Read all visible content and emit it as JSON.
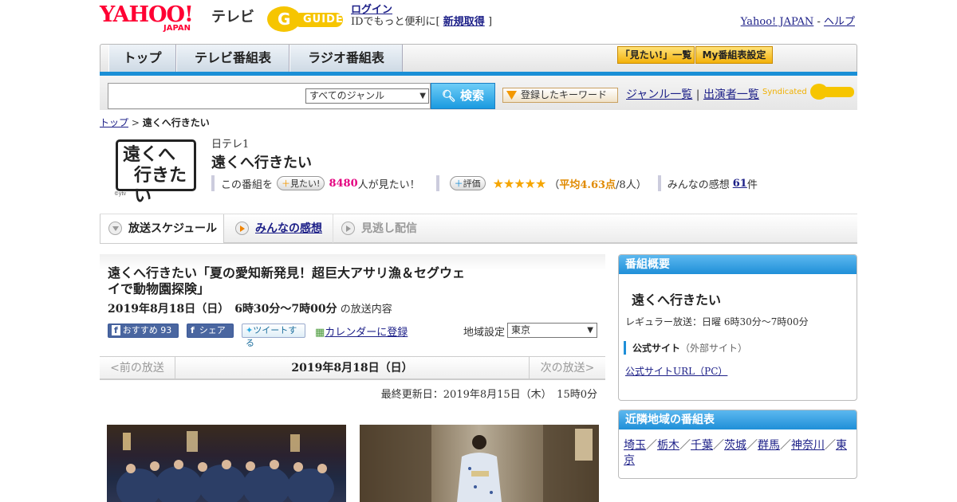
{
  "header": {
    "brand_yahoo": "YAHOO!",
    "brand_japan": "JAPAN",
    "brand_tv": "テレビ",
    "brand_gguide": "GUIDE",
    "login": "ログイン",
    "login_note_prefix": "IDでもっと便利に[",
    "signup": "新規取得",
    "login_note_suffix": "]",
    "yahoo_japan": "Yahoo! JAPAN",
    "sep": "-",
    "help": "ヘルプ"
  },
  "nav": {
    "tabs": [
      {
        "label": "トップ"
      },
      {
        "label": "テレビ番組表"
      },
      {
        "label": "ラジオ番組表"
      }
    ],
    "mitai_list": "「見たい!」一覧",
    "my_schedule": "My番組表設定"
  },
  "search": {
    "genre_select": "すべてのジャンル",
    "button": "検索",
    "keyword_button": "登録したキーワード",
    "genre_list": "ジャンル一覧",
    "divider": "|",
    "performer_list": "出演者一覧",
    "syndicated": "Syndicated"
  },
  "breadcrumb": {
    "top": "トップ",
    "sep": ">",
    "current": "遠くへ行きたい"
  },
  "program": {
    "logo_line1": "遠くへ",
    "logo_line2": "行きたい",
    "logo_credit": "©ytv",
    "channel": "日テレ1",
    "title": "遠くへ行きたい",
    "mitai_prefix": "この番組を",
    "mitai_button": "見たい!",
    "mitai_count": "8480",
    "mitai_suffix": "人が見たい！",
    "rating_button": "評価",
    "stars": "★★★★★",
    "rating_open": "（",
    "rating_avg": "平均4.63点",
    "rating_count": "/8人）",
    "kanso_label": "みんなの感想",
    "kanso_count": "61",
    "kanso_unit": "件"
  },
  "tabs": {
    "schedule": "放送スケジュール",
    "kanso": "みんなの感想",
    "minogashi": "見逃し配信"
  },
  "episode": {
    "title": "遠くへ行きたい「夏の愛知新発見！超巨大アサリ漁＆セグウェイで動物園探険」",
    "date": "2019年8月18日（日）　6時30分～7時00分",
    "date_suffix": "の放送内容",
    "fb_like": "おすすめ 93",
    "fb_share": "シェア",
    "tweet": "ツイートする",
    "calendar": "カレンダーに登録",
    "region_label": "地域設定",
    "region_value": "東京"
  },
  "date_nav": {
    "prev": "<前の放送",
    "current": "2019年8月18日（日）",
    "next": "次の放送>"
  },
  "updated": "最終更新日：2019年8月15日（木）　15時0分",
  "overview": {
    "heading": "番組概要",
    "title": "遠くへ行きたい",
    "regular": "レギュラー放送：日曜 6時30分～7時00分",
    "site_label": "公式サイト",
    "site_note": "（外部サイト）",
    "site_link": "公式サイトURL（PC）"
  },
  "nearby": {
    "heading": "近隣地域の番組表",
    "sep": "／",
    "regions": [
      "埼玉",
      "栃木",
      "千葉",
      "茨城",
      "群馬",
      "神奈川",
      "東京"
    ]
  },
  "colors": {
    "accent_blue": "#1a8fd6",
    "link": "#1d2088",
    "pink": "#e4007f",
    "star": "#f5a500"
  }
}
